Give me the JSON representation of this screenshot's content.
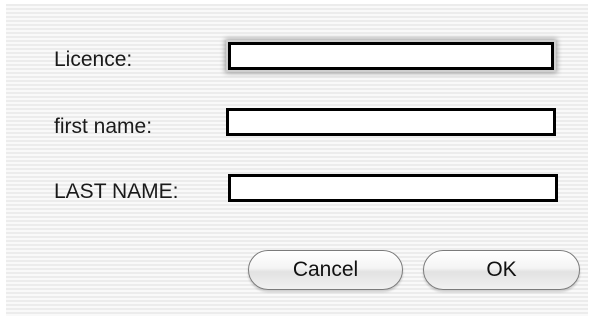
{
  "form": {
    "fields": [
      {
        "label": "Licence:",
        "value": ""
      },
      {
        "label": "first name:",
        "value": ""
      },
      {
        "label": "LAST NAME:",
        "value": ""
      }
    ]
  },
  "buttons": {
    "cancel_label": "Cancel",
    "ok_label": "OK"
  }
}
